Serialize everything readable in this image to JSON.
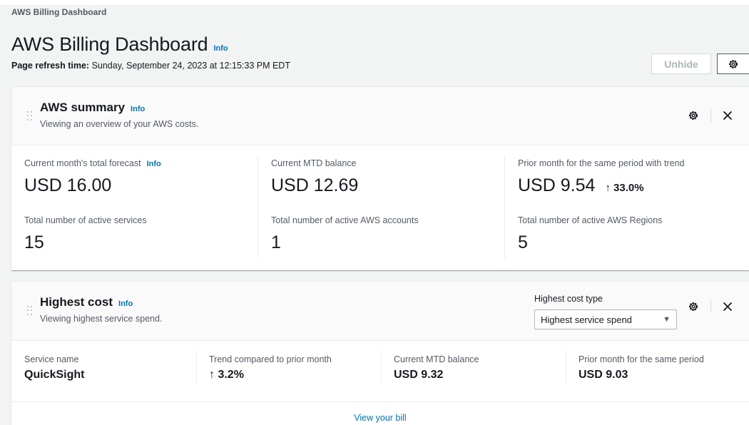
{
  "breadcrumb": "AWS Billing Dashboard",
  "header": {
    "title": "AWS Billing Dashboard",
    "info": "Info",
    "refresh_label": "Page refresh time:",
    "refresh_value": "Sunday, September 24, 2023 at 12:15:33 PM EDT",
    "unhide_label": "Unhide"
  },
  "summary": {
    "title": "AWS summary",
    "info": "Info",
    "description": "Viewing an overview of your AWS costs.",
    "metrics": [
      {
        "label": "Current month's total forecast",
        "info": "Info",
        "value": "USD 16.00"
      },
      {
        "label": "Current MTD balance",
        "value": "USD 12.69"
      },
      {
        "label": "Prior month for the same period with trend",
        "value": "USD 9.54",
        "trend": "↑ 33.0%"
      },
      {
        "label": "Total number of active services",
        "value": "15"
      },
      {
        "label": "Total number of active AWS accounts",
        "value": "1"
      },
      {
        "label": "Total number of active AWS Regions",
        "value": "5"
      }
    ]
  },
  "highest_cost": {
    "title": "Highest cost",
    "info": "Info",
    "description": "Viewing highest service spend.",
    "select_label": "Highest cost type",
    "select_value": "Highest service spend",
    "columns": [
      {
        "label": "Service name",
        "value": "QuickSight"
      },
      {
        "label": "Trend compared to prior month",
        "value": "↑ 3.2%"
      },
      {
        "label": "Current MTD balance",
        "value": "USD 9.32"
      },
      {
        "label": "Prior month for the same period",
        "value": "USD 9.03"
      }
    ],
    "footer_link": "View your bill"
  },
  "icons": {
    "settings": "gear-icon",
    "close": "close-icon",
    "drag": "drag-handle-icon",
    "dropdown": "caret-down-icon"
  },
  "colors": {
    "link": "#0073bb",
    "page_bg": "#f2f3f3",
    "text": "#16191f",
    "muted": "#545b64"
  }
}
